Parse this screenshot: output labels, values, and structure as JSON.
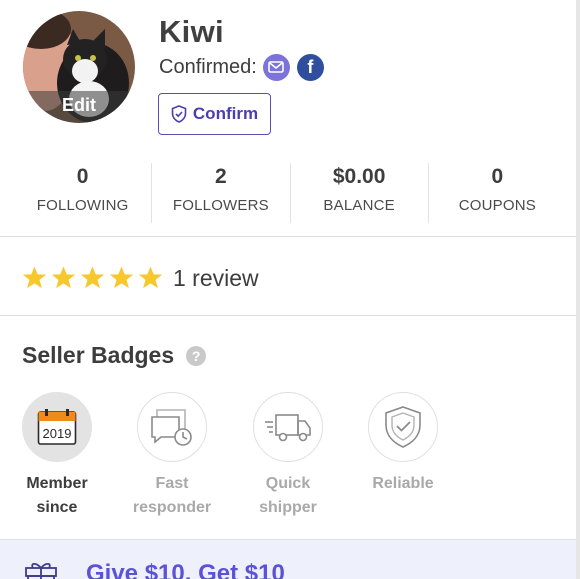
{
  "profile": {
    "username": "Kiwi",
    "avatar_edit_label": "Edit",
    "confirmed_label": "Confirmed:",
    "confirmed_icons": [
      "email-icon",
      "facebook-icon"
    ],
    "confirm_button_label": "Confirm"
  },
  "stats": [
    {
      "value": "0",
      "label": "FOLLOWING"
    },
    {
      "value": "2",
      "label": "FOLLOWERS"
    },
    {
      "value": "$0.00",
      "label": "BALANCE"
    },
    {
      "value": "0",
      "label": "COUPONS"
    }
  ],
  "reviews": {
    "stars": 5,
    "count_label": "1 review",
    "star_color": "#f6c82d"
  },
  "seller_badges": {
    "title": "Seller Badges",
    "items": [
      {
        "label": "Member since",
        "icon": "calendar-icon",
        "calendar_year": "2019",
        "earned": true
      },
      {
        "label": "Fast responder",
        "icon": "chat-clock-icon",
        "earned": false
      },
      {
        "label": "Quick shipper",
        "icon": "truck-icon",
        "earned": false
      },
      {
        "label": "Reliable",
        "icon": "shield-check-icon",
        "earned": false
      }
    ]
  },
  "invite": {
    "text": "Give $10, Get $10",
    "icon": "gift-icon"
  },
  "colors": {
    "accent": "#5b52d6",
    "email_badge": "#7b73d9",
    "facebook_badge": "#2f4f9e",
    "calendar_orange": "#f08a1c"
  }
}
